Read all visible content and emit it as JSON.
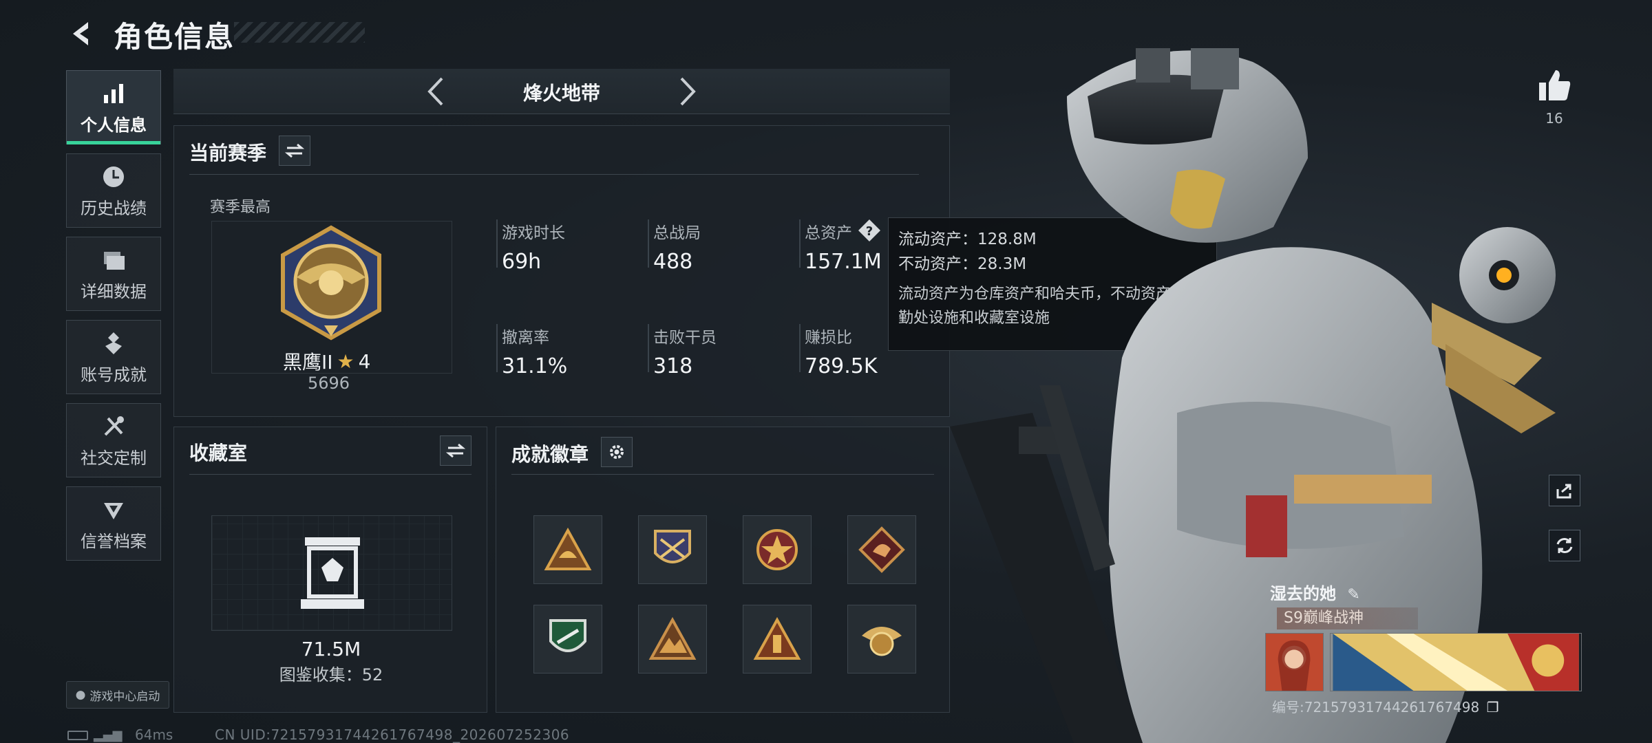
{
  "header": {
    "title": "角色信息"
  },
  "nav": {
    "items": [
      {
        "label": "个人信息",
        "icon": "bar-chart-icon",
        "active": true
      },
      {
        "label": "历史战绩",
        "icon": "history-clock-icon"
      },
      {
        "label": "详细数据",
        "icon": "folder-icon"
      },
      {
        "label": "账号成就",
        "icon": "achievement-icon"
      },
      {
        "label": "社交定制",
        "icon": "tools-icon"
      },
      {
        "label": "信誉档案",
        "icon": "reputation-icon"
      }
    ],
    "game_center": "游戏中心启动"
  },
  "mode": {
    "title": "烽火地带"
  },
  "season": {
    "title": "当前赛季",
    "best_label": "赛季最高",
    "rank_name": "黑鹰II",
    "rank_stars": "4",
    "rank_score": "5696",
    "stats": [
      {
        "label": "游戏时长",
        "value": "69h"
      },
      {
        "label": "总战局",
        "value": "488"
      },
      {
        "label": "总资产",
        "value": "157.1M"
      },
      {
        "label": "撤离率",
        "value": "31.1%"
      },
      {
        "label": "击败干员",
        "value": "318"
      },
      {
        "label": "赚损比",
        "value": "789.5K"
      }
    ]
  },
  "tooltip": {
    "liquid": "流动资产：128.8M",
    "fixed": "不动资产：28.3M",
    "note": "流动资产为仓库资产和哈夫币，不动资产为特勤处设施和收藏室设施"
  },
  "collection": {
    "title": "收藏室",
    "value": "71.5M",
    "catalog": "图鉴收集：52"
  },
  "badges": {
    "title": "成就徽章"
  },
  "player": {
    "likes": "16",
    "name": "湿去的她",
    "title_tag": "S9巅峰战神",
    "id": "编号:72157931744261767498"
  },
  "footer": {
    "ping": "64ms",
    "uid": "CN UID:72157931744261767498_202607252306"
  },
  "colors": {
    "accent": "#38d39a",
    "panel": "#1c2228",
    "gold": "#c99a45"
  }
}
